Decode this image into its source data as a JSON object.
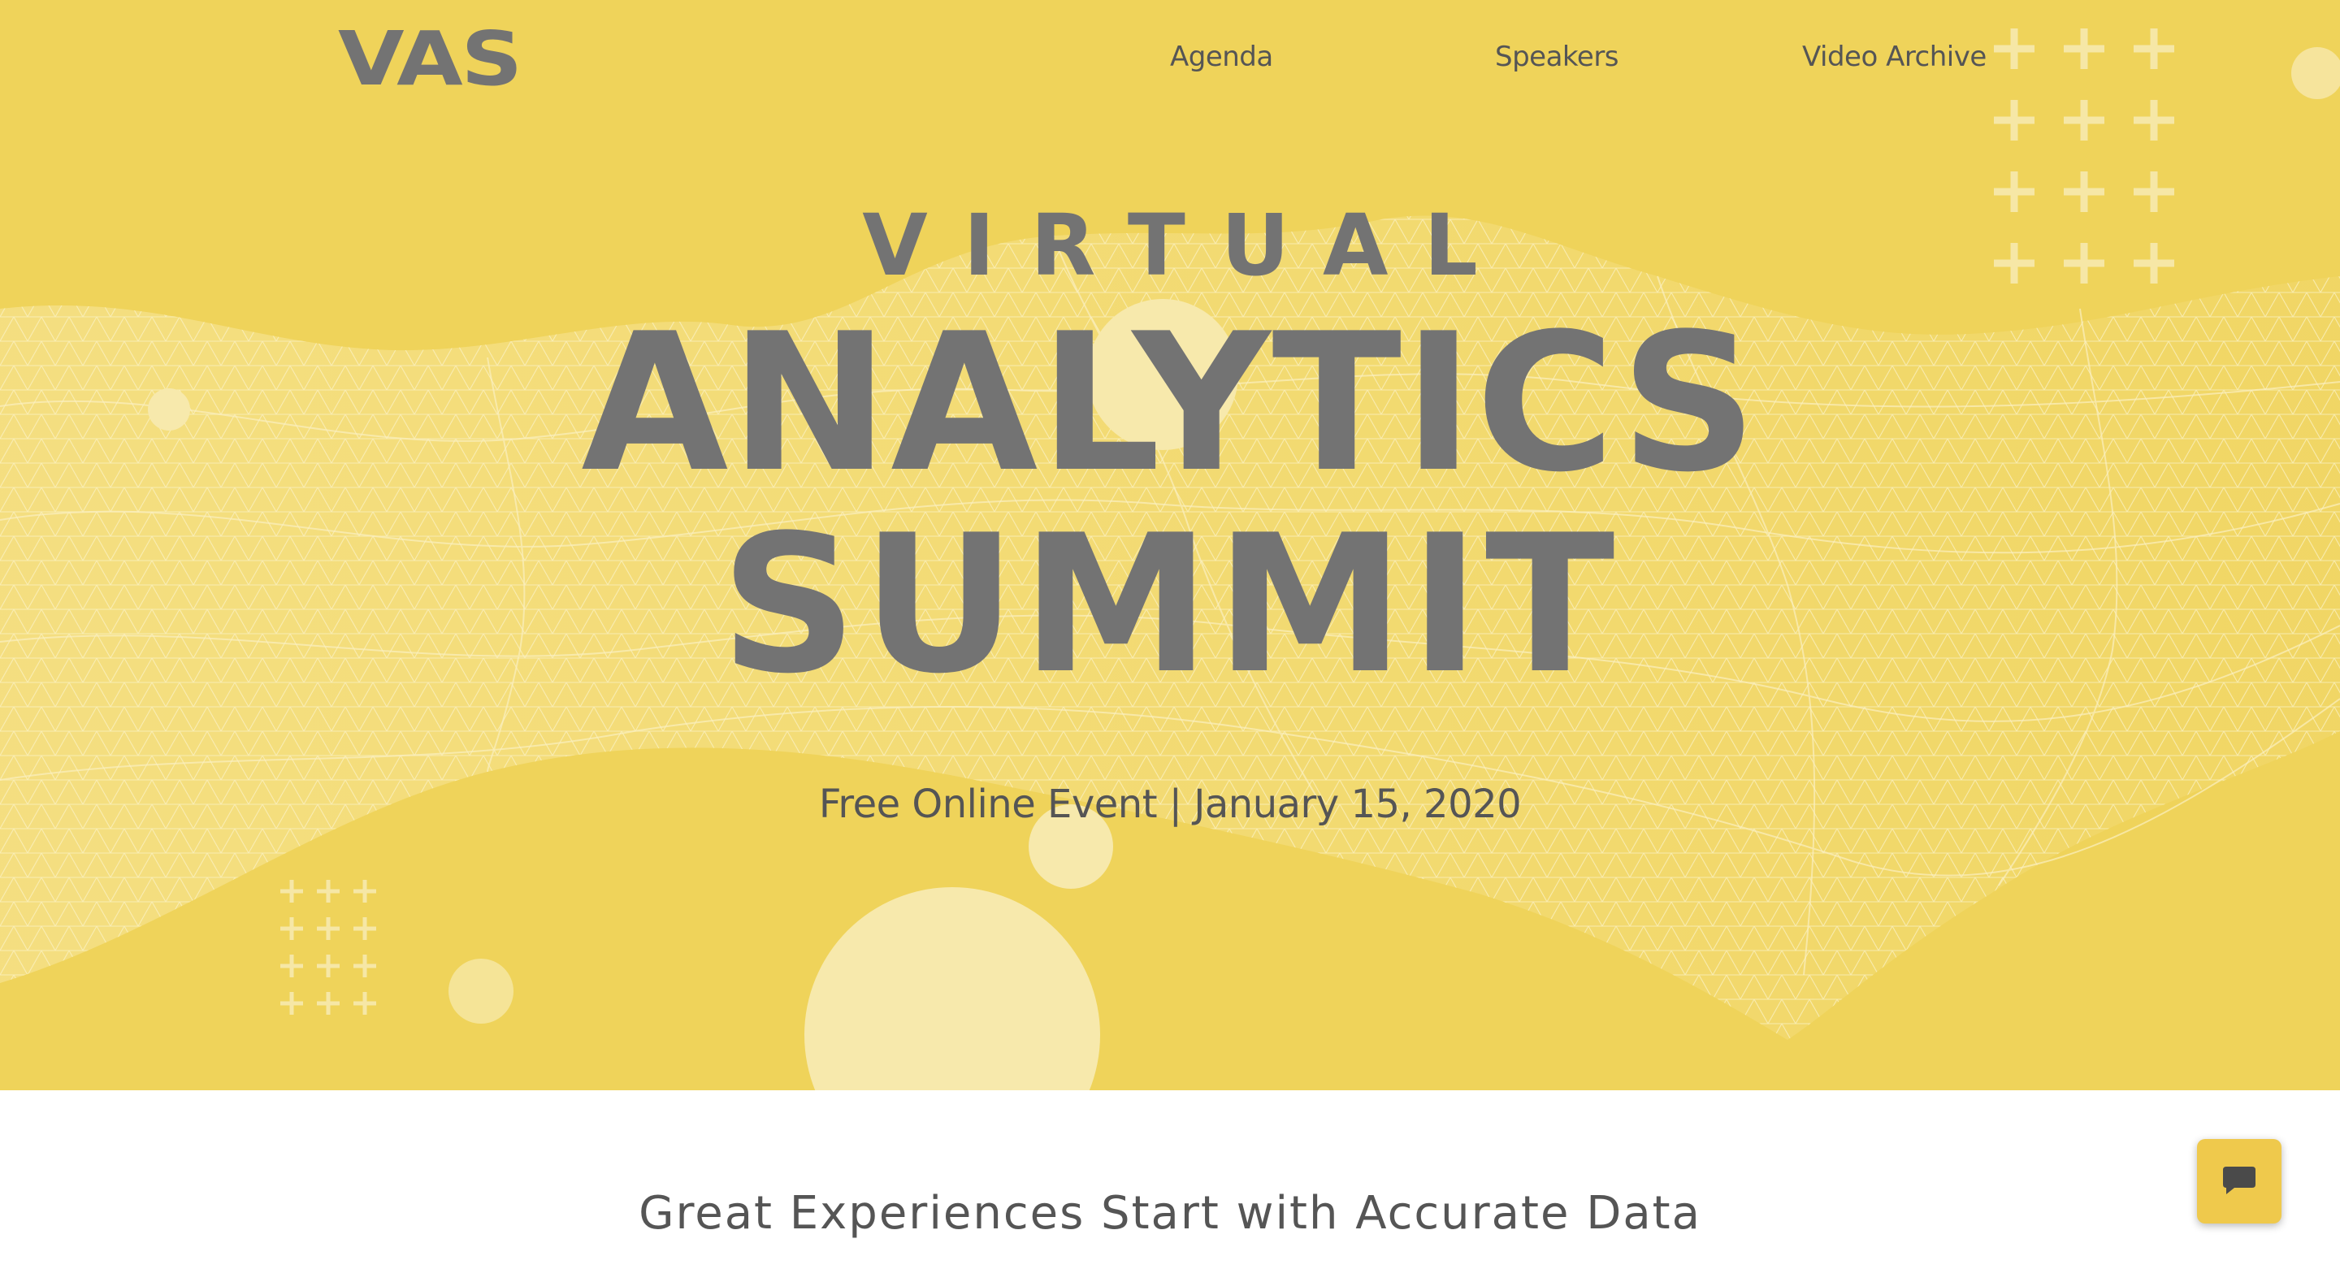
{
  "brand": {
    "logo_text": "VAS",
    "colors": {
      "hero_background": "#efd35a",
      "text_gray": "#737373",
      "decor_light": "#f7e9ac",
      "chat_button": "#efc94c"
    }
  },
  "nav": {
    "items": [
      {
        "label": "Agenda"
      },
      {
        "label": "Speakers"
      },
      {
        "label": "Video Archive"
      }
    ]
  },
  "hero": {
    "line1": "VIRTUAL",
    "line2": "ANALYTICS",
    "line3": "SUMMIT",
    "subtitle": "Free Online Event | January 15, 2020"
  },
  "section": {
    "tagline": "Great Experiences Start with Accurate Data"
  },
  "chat": {
    "icon": "chat-bubble-icon"
  }
}
